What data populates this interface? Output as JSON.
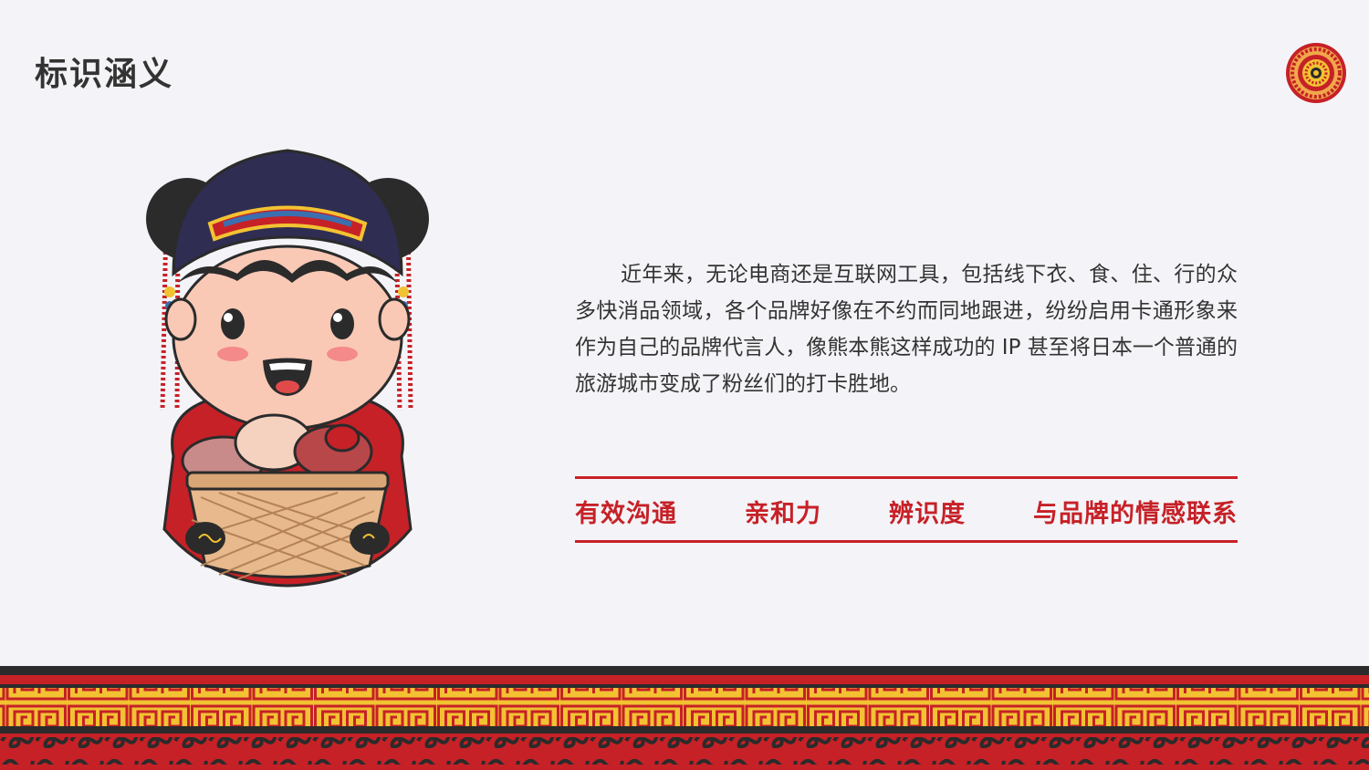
{
  "page": {
    "title": "标识涵义",
    "paragraph": "近年来，无论电商还是互联网工具，包括线下衣、食、住、行的众多快消品领域，各个品牌好像在不约而同地跟进，纷纷启用卡通形象来作为自己的品牌代言人，像熊本熊这样成功的 IP 甚至将日本一个普通的旅游城市变成了粉丝们的打卡胜地。",
    "keywords": [
      "有效沟通",
      "亲和力",
      "辨识度",
      "与品牌的情感联系"
    ]
  },
  "icons": {
    "logo": "round-ornament-logo",
    "illustration": "mascot-girl-with-meat-basket",
    "footer": "greek-key-border"
  },
  "colors": {
    "accent": "#c62127",
    "text": "#333333",
    "background": "#f4f4f8",
    "gold": "#f2c232",
    "dark": "#2b2b2b"
  }
}
